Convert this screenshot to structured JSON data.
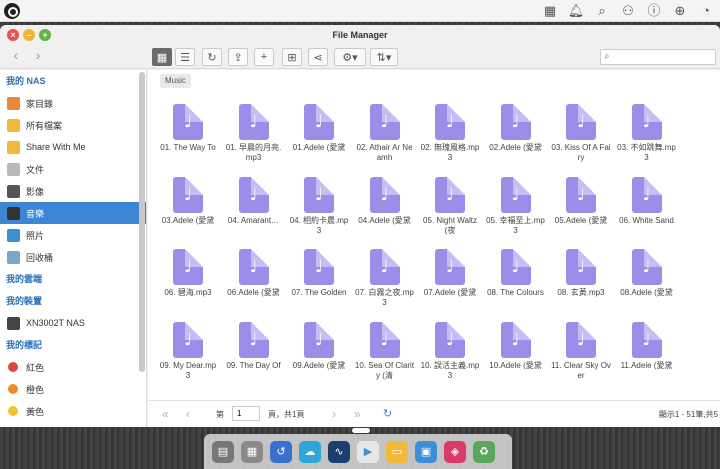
{
  "window": {
    "title": "File Manager"
  },
  "search": {
    "placeholder": ""
  },
  "breadcrumb": "Music",
  "sidebar": {
    "sections": [
      {
        "heading": "我的 NAS",
        "items": [
          {
            "label": "家目錄",
            "icon": "home-icon",
            "color": "#e9873a"
          },
          {
            "label": "所有檔案",
            "icon": "folder-icon",
            "color": "#f0b93a"
          },
          {
            "label": "Share With Me",
            "icon": "share-folder-icon",
            "color": "#f0b93a"
          },
          {
            "label": "文件",
            "icon": "document-icon",
            "color": "#b9b9b9"
          },
          {
            "label": "影像",
            "icon": "video-icon",
            "color": "#555555"
          },
          {
            "label": "音樂",
            "icon": "music-icon",
            "color": "#333333",
            "selected": true
          },
          {
            "label": "照片",
            "icon": "photo-icon",
            "color": "#3a8fd6"
          },
          {
            "label": "回收桶",
            "icon": "trash-icon",
            "color": "#7aa6c8"
          }
        ]
      },
      {
        "heading": "我的雲端",
        "items": []
      },
      {
        "heading": "我的裝置",
        "items": [
          {
            "label": "XN3002T NAS",
            "icon": "nas-device-icon",
            "color": "#444444"
          }
        ]
      },
      {
        "heading": "我的標記",
        "items": [
          {
            "label": "紅色",
            "icon": "tag-dot-icon",
            "color": "#e0483e"
          },
          {
            "label": "橙色",
            "icon": "tag-dot-icon",
            "color": "#f08c28"
          },
          {
            "label": "黃色",
            "icon": "tag-dot-icon",
            "color": "#f0c22e"
          }
        ]
      }
    ]
  },
  "files": [
    [
      "01. The Way To",
      "01. 早晨的月亮.mp3",
      "01.Adele (愛黛",
      "02. Athair Ar Neamh",
      "02. 無瑰風格.mp3",
      "02.Adele (愛黛",
      "03. Kiss Of A Fairy",
      "03. 不如跳舞.mp3"
    ],
    [
      "03.Adele (愛黛",
      "04. Amarant…",
      "04. 相約卡農.mp3",
      "04.Adele (愛黛",
      "05. Night Waltz (夜",
      "05. 幸福至上.mp3",
      "05.Adele (愛黛",
      "06. White Sand"
    ],
    [
      "06. 碧海.mp3",
      "06.Adele (愛黛",
      "07. The Golden",
      "07. 白霧之夜.mp3",
      "07.Adele (愛黛",
      "08. The Colours",
      "08. 玄黃.mp3",
      "08.Adele (愛黛"
    ],
    [
      "09. My Dear.mp3",
      "09. The Day Of",
      "09.Adele (愛黛",
      "10. Sea Of Clarity (清",
      "10. 誤活主義.mp3",
      "10.Adele (愛黛",
      "11. Clear Sky Over",
      "11.Adele (愛黛"
    ]
  ],
  "pagination": {
    "page_label": "第",
    "page_value": "1",
    "total_label": "頁，共1頁",
    "count_text": "顯示1 - 51筆,共5"
  },
  "colors": {
    "accent": "#3d86d6",
    "file_icon": "#9b8ee8"
  },
  "dock_apps": [
    {
      "icon": "app-switcher-icon",
      "color": "#777777"
    },
    {
      "icon": "apps-grid-icon",
      "color": "#8a8a8a"
    },
    {
      "icon": "backup-icon",
      "color": "#3a6fd0"
    },
    {
      "icon": "cloud-sync-icon",
      "color": "#2fa6d8"
    },
    {
      "icon": "activity-icon",
      "color": "#1c3e6e"
    },
    {
      "icon": "media-player-icon",
      "color": "#e7e7e7"
    },
    {
      "icon": "file-manager-icon",
      "color": "#f0b93a"
    },
    {
      "icon": "remote-desktop-icon",
      "color": "#3a8fd6"
    },
    {
      "icon": "security-icon",
      "color": "#d83a6a"
    },
    {
      "icon": "recycle-bin-icon",
      "color": "#5aa65a"
    }
  ]
}
